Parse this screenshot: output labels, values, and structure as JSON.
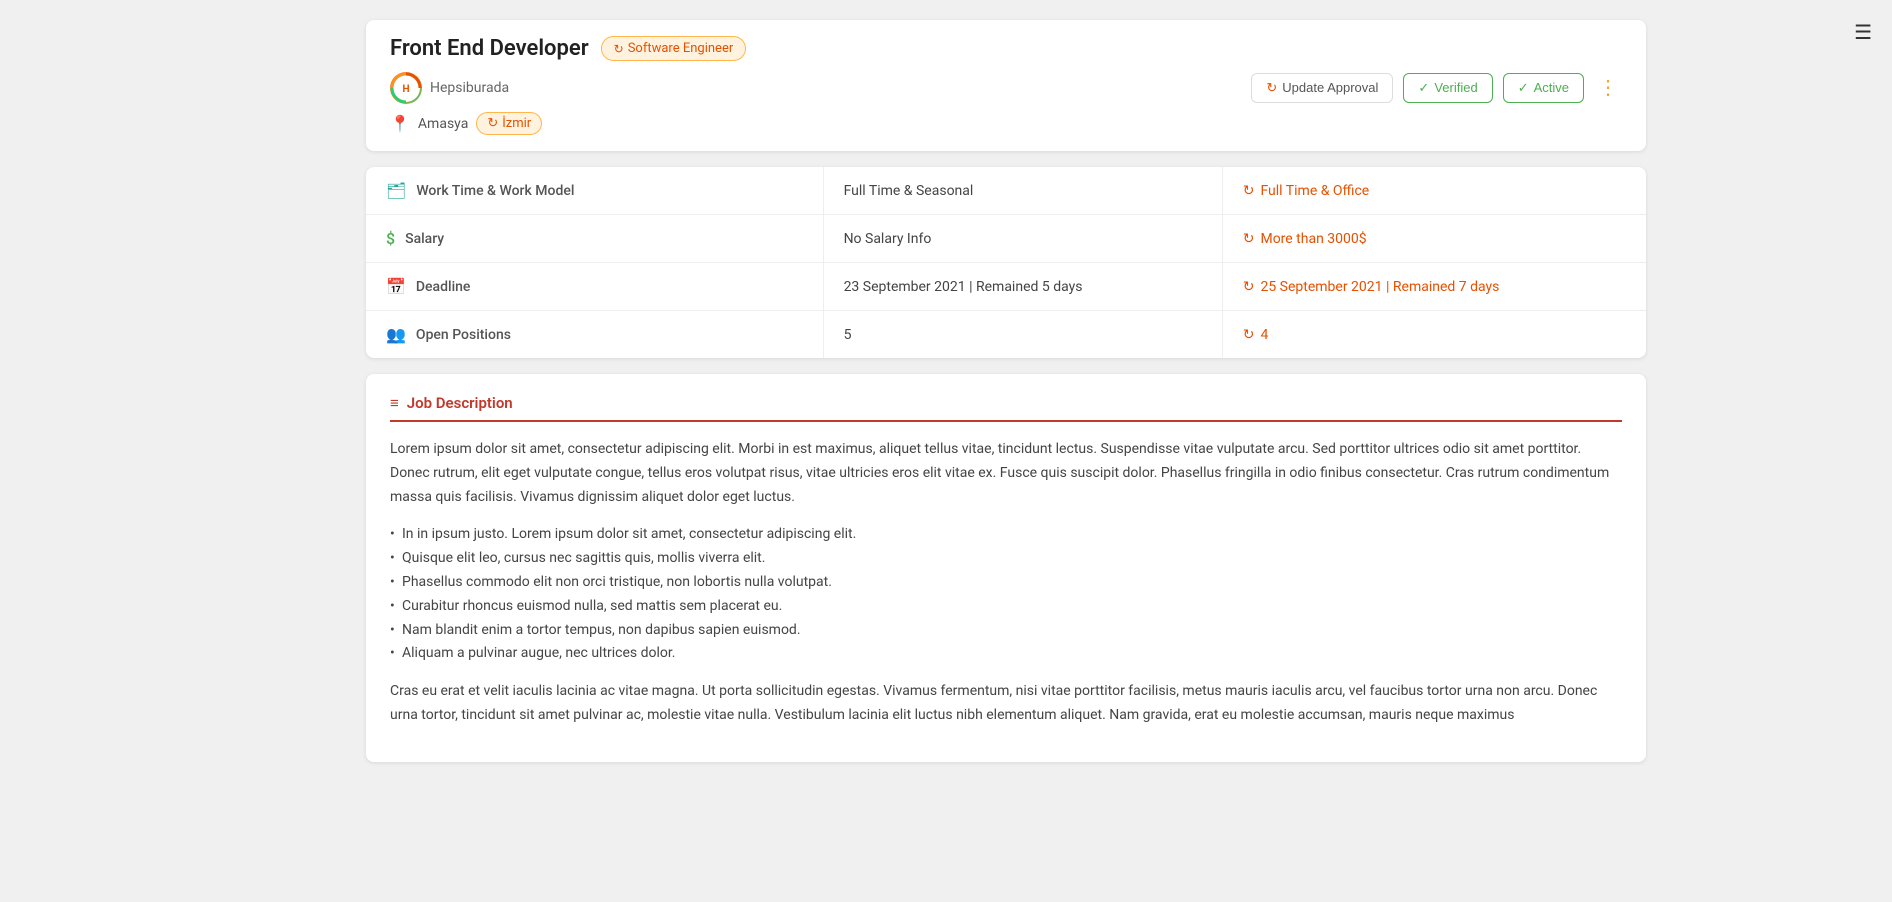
{
  "hamburger": "☰",
  "header": {
    "job_title": "Front End Developer",
    "tag_badge": "Software Engineer",
    "company_name": "Hepsiburada",
    "company_logo_text": "H",
    "location": "Amasya",
    "location_tag": "İzmir",
    "actions": {
      "update_approval": "Update Approval",
      "verified": "Verified",
      "active": "Active"
    }
  },
  "details": {
    "rows": [
      {
        "icon": "briefcase",
        "label": "Work Time & Work Model",
        "value": "Full Time & Seasonal",
        "updated": "Full Time & Office"
      },
      {
        "icon": "dollar",
        "label": "Salary",
        "value": "No Salary Info",
        "updated": "More than 3000$"
      },
      {
        "icon": "calendar",
        "label": "Deadline",
        "value": "23 September 2021 | Remained 5 days",
        "updated": "25 September 2021 | Remained 7 days"
      },
      {
        "icon": "people",
        "label": "Open Positions",
        "value": "5",
        "updated": "4"
      }
    ]
  },
  "description": {
    "section_title": "Job Description",
    "paragraphs": [
      "Lorem ipsum dolor sit amet, consectetur adipiscing elit. Morbi in est maximus, aliquet tellus vitae, tincidunt lectus. Suspendisse vitae vulputate arcu. Sed porttitor ultrices odio sit amet porttitor. Donec rutrum, elit eget vulputate congue, tellus eros volutpat risus, vitae ultricies eros elit vitae ex. Fusce quis suscipit dolor. Phasellus fringilla in odio finibus consectetur. Cras rutrum condimentum massa quis facilisis. Vivamus dignissim aliquet dolor eget luctus.",
      "Cras eu erat et velit iaculis lacinia ac vitae magna. Ut porta sollicitudin egestas. Vivamus fermentum, nisi vitae porttitor facilisis, metus mauris iaculis arcu, vel faucibus tortor urna non arcu. Donec urna tortor, tincidunt sit amet pulvinar ac, molestie vitae nulla. Vestibulum lacinia elit luctus nibh elementum aliquet. Nam gravida, erat eu molestie accumsan, mauris neque maximus"
    ],
    "list_items": [
      "In in ipsum justo. Lorem ipsum dolor sit amet, consectetur adipiscing elit.",
      "Quisque elit leo, cursus nec sagittis quis, mollis viverra elit.",
      "Phasellus commodo elit non orci tristique, non lobortis nulla volutpat.",
      "Curabitur rhoncus euismod nulla, sed mattis sem placerat eu.",
      "Nam blandit enim a tortor tempus, non dapibus sapien euismod.",
      "Aliquam a pulvinar augue, nec ultrices dolor."
    ]
  },
  "icons": {
    "refresh": "↻",
    "check_circle": "✓",
    "check": "✓",
    "more_vert": "⋮",
    "list_icon": "≡",
    "location_pin": "📍"
  }
}
